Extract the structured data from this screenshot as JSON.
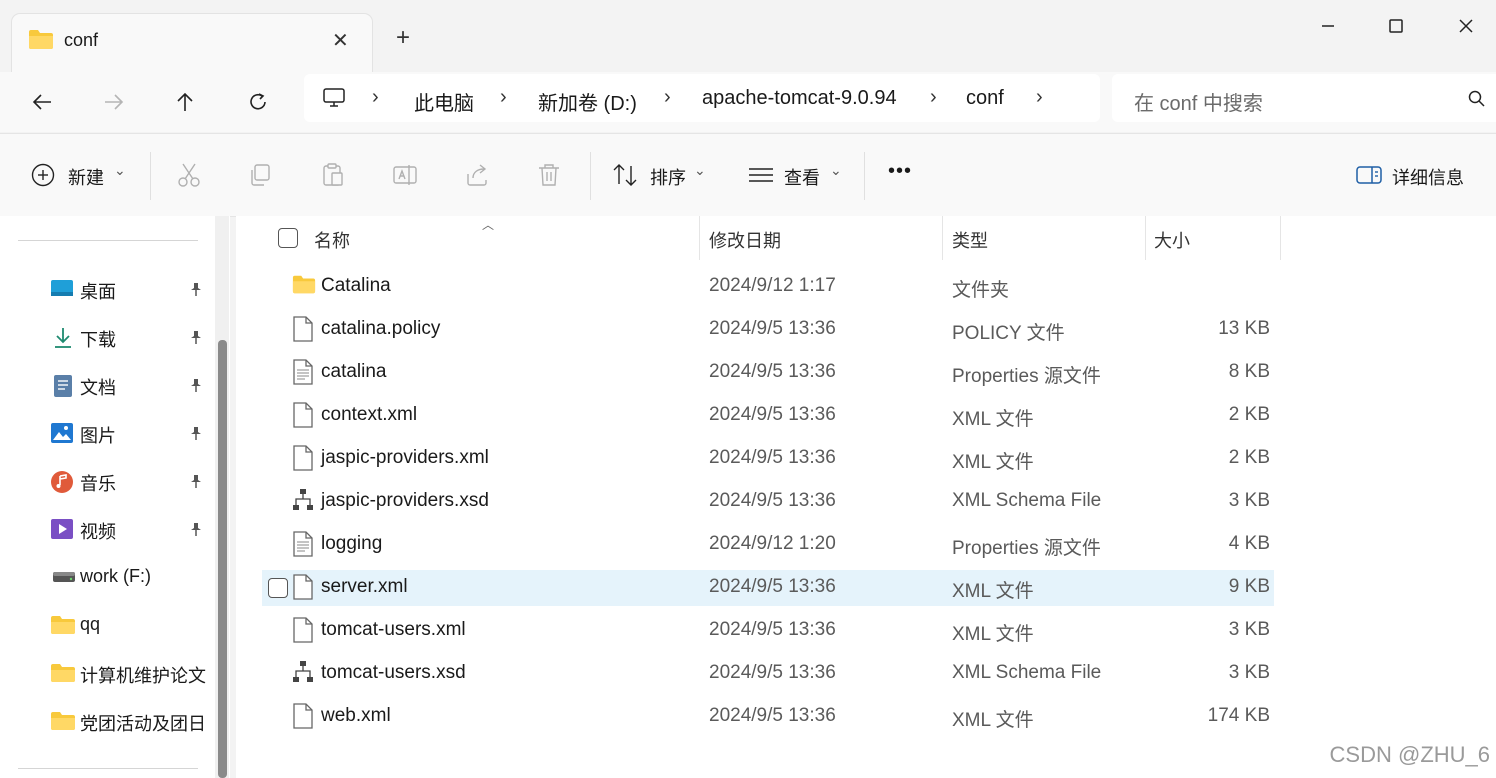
{
  "tab": {
    "title": "conf"
  },
  "address": {
    "crumbs": [
      "此电脑",
      "新加卷 (D:)",
      "apache-tomcat-9.0.94",
      "conf"
    ]
  },
  "search": {
    "placeholder": "在 conf 中搜索"
  },
  "toolbar": {
    "new_label": "新建",
    "sort_label": "排序",
    "view_label": "查看",
    "more_label": "•••",
    "details_label": "详细信息"
  },
  "sidebar": {
    "items": [
      {
        "label": "桌面",
        "pinned": true,
        "icon": "desktop-icon"
      },
      {
        "label": "下载",
        "pinned": true,
        "icon": "download-icon"
      },
      {
        "label": "文档",
        "pinned": true,
        "icon": "document-icon"
      },
      {
        "label": "图片",
        "pinned": true,
        "icon": "pictures-icon"
      },
      {
        "label": "音乐",
        "pinned": true,
        "icon": "music-icon"
      },
      {
        "label": "视频",
        "pinned": true,
        "icon": "video-icon"
      },
      {
        "label": "work (F:)",
        "pinned": false,
        "icon": "drive-icon"
      },
      {
        "label": "qq",
        "pinned": false,
        "icon": "folder-icon"
      },
      {
        "label": "计算机维护论文",
        "pinned": false,
        "icon": "folder-icon"
      },
      {
        "label": "党团活动及团日",
        "pinned": false,
        "icon": "folder-icon"
      }
    ]
  },
  "columns": {
    "name": "名称",
    "date": "修改日期",
    "type": "类型",
    "size": "大小"
  },
  "files": [
    {
      "name": "Catalina",
      "date": "2024/9/12 1:17",
      "type": "文件夹",
      "size": "",
      "icon": "folder-icon"
    },
    {
      "name": "catalina.policy",
      "date": "2024/9/5 13:36",
      "type": "POLICY 文件",
      "size": "13 KB",
      "icon": "file-icon"
    },
    {
      "name": "catalina",
      "date": "2024/9/5 13:36",
      "type": "Properties 源文件",
      "size": "8 KB",
      "icon": "text-file-icon"
    },
    {
      "name": "context.xml",
      "date": "2024/9/5 13:36",
      "type": "XML 文件",
      "size": "2 KB",
      "icon": "file-icon"
    },
    {
      "name": "jaspic-providers.xml",
      "date": "2024/9/5 13:36",
      "type": "XML 文件",
      "size": "2 KB",
      "icon": "file-icon"
    },
    {
      "name": "jaspic-providers.xsd",
      "date": "2024/9/5 13:36",
      "type": "XML Schema File",
      "size": "3 KB",
      "icon": "schema-icon"
    },
    {
      "name": "logging",
      "date": "2024/9/12 1:20",
      "type": "Properties 源文件",
      "size": "4 KB",
      "icon": "text-file-icon"
    },
    {
      "name": "server.xml",
      "date": "2024/9/5 13:36",
      "type": "XML 文件",
      "size": "9 KB",
      "icon": "file-icon",
      "selected": true
    },
    {
      "name": "tomcat-users.xml",
      "date": "2024/9/5 13:36",
      "type": "XML 文件",
      "size": "3 KB",
      "icon": "file-icon"
    },
    {
      "name": "tomcat-users.xsd",
      "date": "2024/9/5 13:36",
      "type": "XML Schema File",
      "size": "3 KB",
      "icon": "schema-icon"
    },
    {
      "name": "web.xml",
      "date": "2024/9/5 13:36",
      "type": "XML 文件",
      "size": "174 KB",
      "icon": "file-icon"
    }
  ],
  "watermark": "CSDN @ZHU_6"
}
